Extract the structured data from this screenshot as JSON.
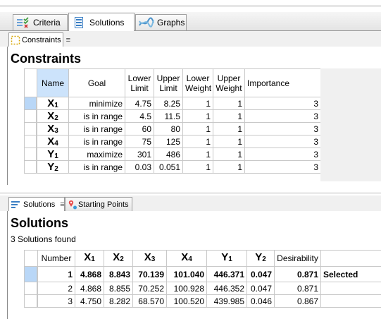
{
  "main_tabs": [
    {
      "label": "Criteria",
      "icon": "criteria-icon"
    },
    {
      "label": "Solutions",
      "icon": "solutions-icon"
    },
    {
      "label": "Graphs",
      "icon": "graphs-icon"
    }
  ],
  "constraints_tab": {
    "label": "Constraints",
    "menu_glyph": "≡"
  },
  "constraints_heading": "Constraints",
  "constraints_columns": [
    "Name",
    "Goal",
    "Lower\nLimit",
    "Upper\nLimit",
    "Lower\nWeight",
    "Upper\nWeight",
    "Importance"
  ],
  "constraints_rows": [
    {
      "name": "X",
      "sub": "1",
      "goal": "minimize",
      "lower_limit": "4.75",
      "upper_limit": "8.25",
      "lower_weight": "1",
      "upper_weight": "1",
      "importance": "3"
    },
    {
      "name": "X",
      "sub": "2",
      "goal": "is in range",
      "lower_limit": "4.5",
      "upper_limit": "11.5",
      "lower_weight": "1",
      "upper_weight": "1",
      "importance": "3"
    },
    {
      "name": "X",
      "sub": "3",
      "goal": "is in range",
      "lower_limit": "60",
      "upper_limit": "80",
      "lower_weight": "1",
      "upper_weight": "1",
      "importance": "3"
    },
    {
      "name": "X",
      "sub": "4",
      "goal": "is in range",
      "lower_limit": "75",
      "upper_limit": "125",
      "lower_weight": "1",
      "upper_weight": "1",
      "importance": "3"
    },
    {
      "name": "Y",
      "sub": "1",
      "goal": "maximize",
      "lower_limit": "301",
      "upper_limit": "486",
      "lower_weight": "1",
      "upper_weight": "1",
      "importance": "3"
    },
    {
      "name": "Y",
      "sub": "2",
      "goal": "is in range",
      "lower_limit": "0.03",
      "upper_limit": "0.051",
      "lower_weight": "1",
      "upper_weight": "1",
      "importance": "3"
    }
  ],
  "lower_tabs": [
    {
      "label": "Solutions",
      "menu_glyph": "≡"
    },
    {
      "label": "Starting Points"
    }
  ],
  "solutions_heading": "Solutions",
  "solutions_found": "3 Solutions found",
  "solutions_columns": [
    {
      "text": "Number"
    },
    {
      "text": "X",
      "sub": "1"
    },
    {
      "text": "X",
      "sub": "2"
    },
    {
      "text": "X",
      "sub": "3"
    },
    {
      "text": "X",
      "sub": "4"
    },
    {
      "text": "Y",
      "sub": "1"
    },
    {
      "text": "Y",
      "sub": "2"
    },
    {
      "text": "Desirability"
    }
  ],
  "solutions_rows": [
    {
      "number": "1",
      "x1": "4.868",
      "x2": "8.843",
      "x3": "70.139",
      "x4": "101.040",
      "y1": "446.371",
      "y2": "0.047",
      "desirability": "0.871",
      "status": "Selected"
    },
    {
      "number": "2",
      "x1": "4.868",
      "x2": "8.855",
      "x3": "70.252",
      "x4": "100.928",
      "y1": "446.352",
      "y2": "0.047",
      "desirability": "0.871",
      "status": ""
    },
    {
      "number": "3",
      "x1": "4.750",
      "x2": "8.282",
      "x3": "68.570",
      "x4": "100.520",
      "y1": "439.985",
      "y2": "0.046",
      "desirability": "0.867",
      "status": ""
    }
  ],
  "colors": {
    "selection": "#b9d7f7",
    "tab_active_bg": "#ffffff",
    "border": "#c8c8c8"
  }
}
